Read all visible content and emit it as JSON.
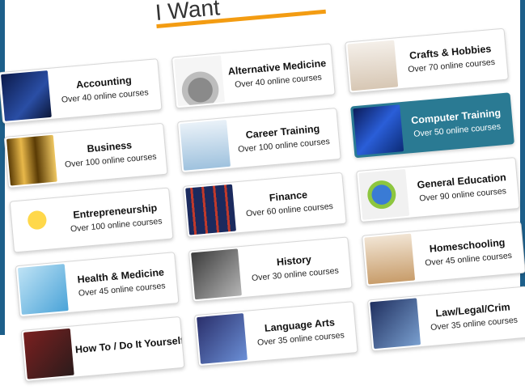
{
  "header": {
    "title": "I Want"
  },
  "categories": [
    {
      "name": "Accounting",
      "sub": "Over 40 online courses",
      "icon": "chart-screen-icon"
    },
    {
      "name": "Alternative Medicine",
      "sub": "Over 40 online courses",
      "icon": "stones-icon"
    },
    {
      "name": "Crafts & Hobbies",
      "sub": "Over 70 online courses",
      "icon": "craft-doll-icon"
    },
    {
      "name": "Business",
      "sub": "Over 100 online courses",
      "icon": "buildings-icon"
    },
    {
      "name": "Career Training",
      "sub": "Over 100 online courses",
      "icon": "presenter-icon"
    },
    {
      "name": "Computer Training",
      "sub": "Over 50 online courses",
      "icon": "circuit-icon"
    },
    {
      "name": "Entrepreneurship",
      "sub": "Over 100 online courses",
      "icon": "lightbulb-icon"
    },
    {
      "name": "Finance",
      "sub": "Over 60 online courses",
      "icon": "stock-board-icon"
    },
    {
      "name": "General Education",
      "sub": "Over 90 online courses",
      "icon": "globe-apple-icon"
    },
    {
      "name": "Health & Medicine",
      "sub": "Over 45 online courses",
      "icon": "medical-cross-icon"
    },
    {
      "name": "History",
      "sub": "Over 30 online courses",
      "icon": "statue-icon"
    },
    {
      "name": "Homeschooling",
      "sub": "Over 45 online courses",
      "icon": "student-icon"
    },
    {
      "name": "How To / Do It Yourself",
      "sub": "",
      "icon": "tools-icon"
    },
    {
      "name": "Language Arts",
      "sub": "Over 35 online courses",
      "icon": "book-icon"
    },
    {
      "name": "Law/Legal/Crim",
      "sub": "Over 35 online courses",
      "icon": "gavel-icon"
    }
  ],
  "active_category": "Computer Training"
}
